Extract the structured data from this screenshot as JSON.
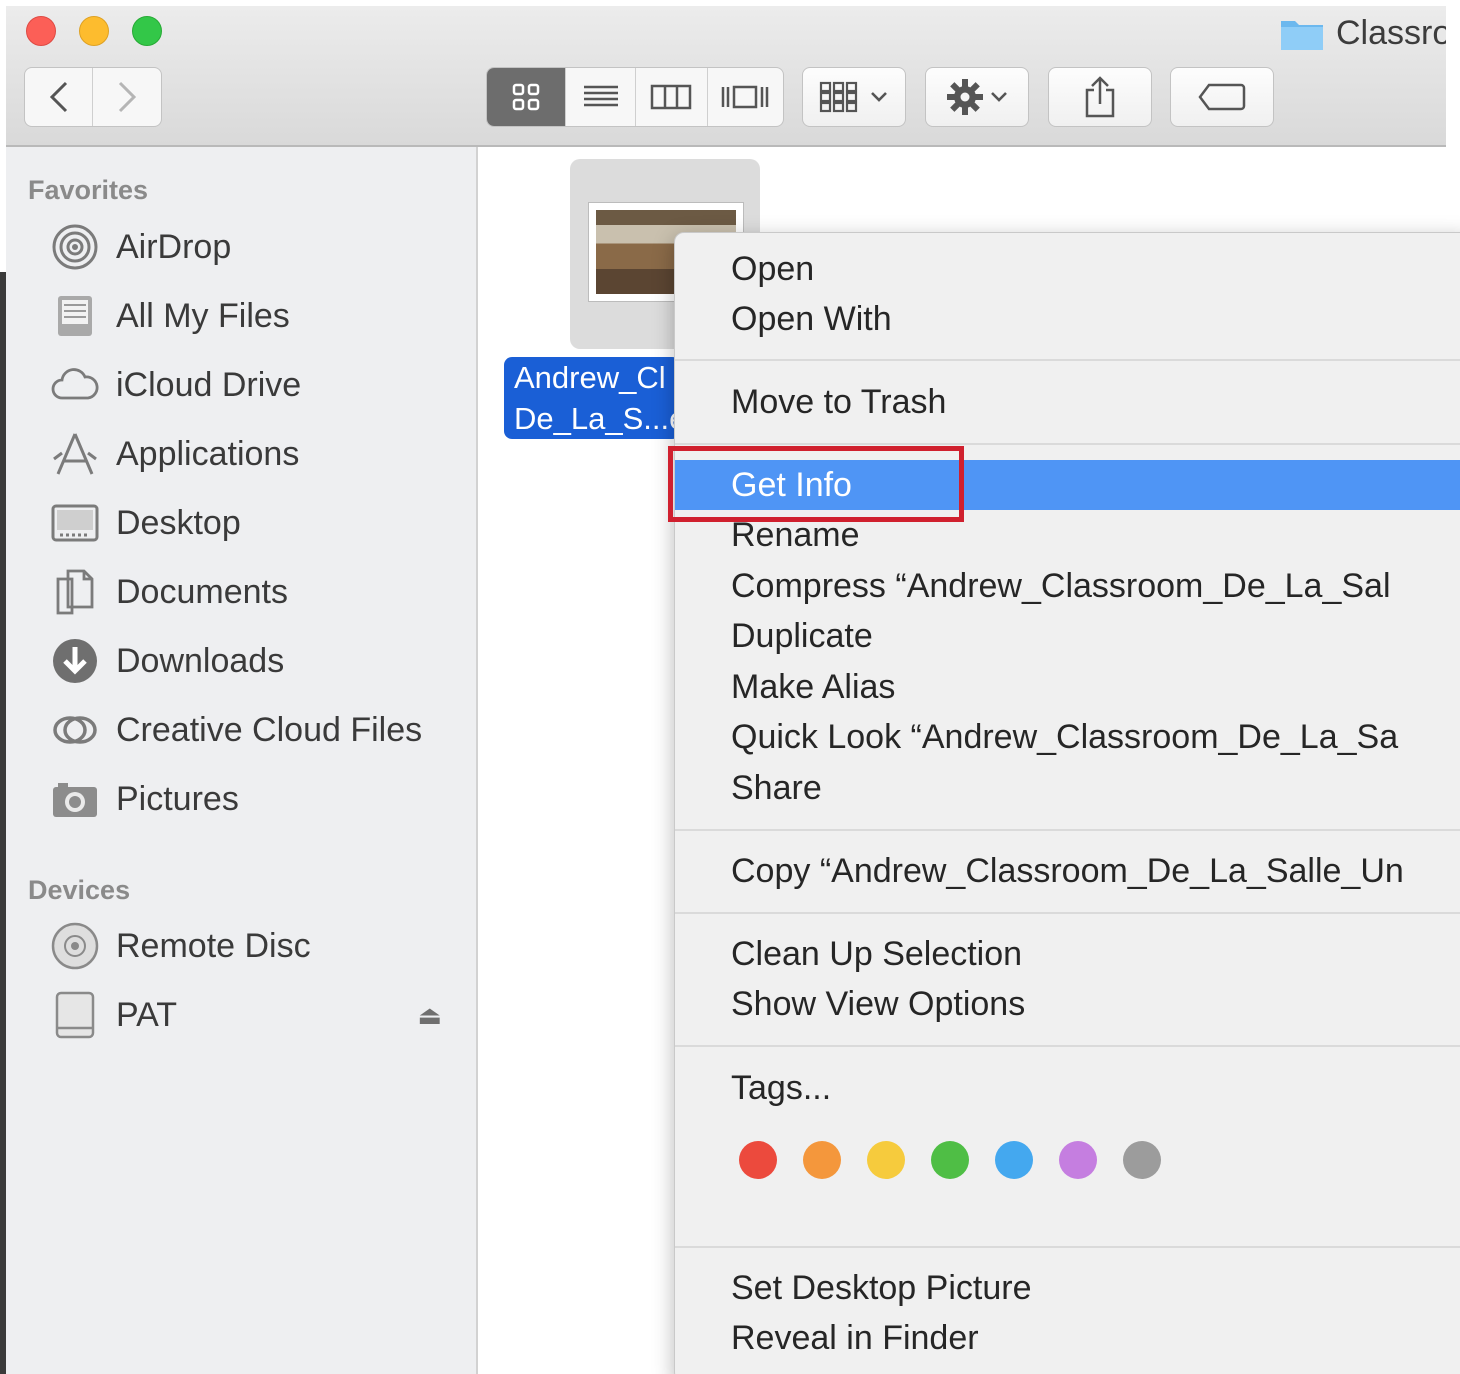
{
  "window": {
    "title": "Classro"
  },
  "sidebar": {
    "favorites_header": "Favorites",
    "favorites": [
      {
        "label": "AirDrop",
        "icon": "airdrop-icon"
      },
      {
        "label": "All My Files",
        "icon": "all-my-files-icon"
      },
      {
        "label": "iCloud Drive",
        "icon": "cloud-icon"
      },
      {
        "label": "Applications",
        "icon": "applications-icon"
      },
      {
        "label": "Desktop",
        "icon": "desktop-icon"
      },
      {
        "label": "Documents",
        "icon": "documents-icon"
      },
      {
        "label": "Downloads",
        "icon": "downloads-icon"
      },
      {
        "label": "Creative Cloud Files",
        "icon": "creative-cloud-icon"
      },
      {
        "label": "Pictures",
        "icon": "camera-icon"
      }
    ],
    "devices_header": "Devices",
    "devices": [
      {
        "label": "Remote Disc",
        "icon": "disc-icon"
      },
      {
        "label": "PAT",
        "icon": "drive-icon"
      }
    ],
    "eject_glyph": "⏏"
  },
  "file": {
    "name_line1": "Andrew_Cl",
    "name_line2": "De_La_S...e"
  },
  "menu": {
    "open": "Open",
    "open_with": "Open With",
    "move_to_trash": "Move to Trash",
    "get_info": "Get Info",
    "rename": "Rename",
    "compress": "Compress “Andrew_Classroom_De_La_Sal",
    "duplicate": "Duplicate",
    "make_alias": "Make Alias",
    "quick_look": "Quick Look “Andrew_Classroom_De_La_Sa",
    "share": "Share",
    "copy": "Copy “Andrew_Classroom_De_La_Salle_Un",
    "clean_up": "Clean Up Selection",
    "show_view_options": "Show View Options",
    "tags": "Tags...",
    "set_desktop": "Set Desktop Picture",
    "reveal": "Reveal in Finder"
  },
  "tag_colors": [
    "#ec4a3d",
    "#f4973c",
    "#f6cb3d",
    "#4fbe45",
    "#44a8ef",
    "#c57ee0",
    "#9c9c9c"
  ],
  "annotation_color": "#d0202e"
}
